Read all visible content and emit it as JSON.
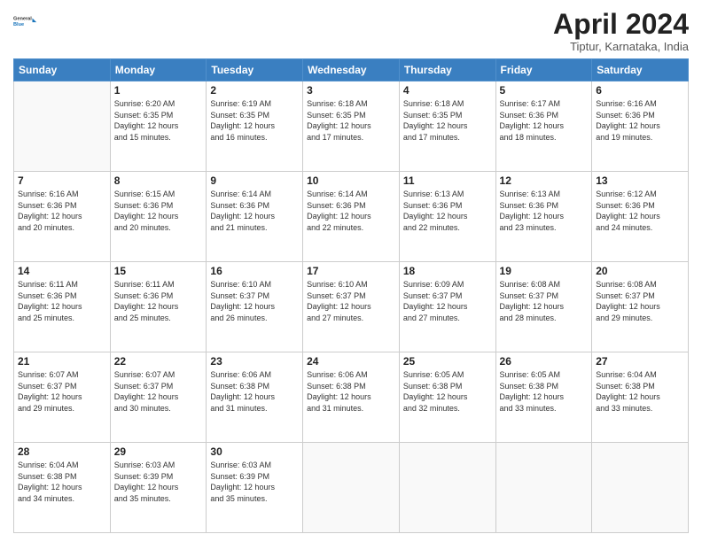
{
  "header": {
    "logo": {
      "line1": "General",
      "line2": "Blue"
    },
    "title": "April 2024",
    "subtitle": "Tiptur, Karnataka, India"
  },
  "calendar": {
    "days_of_week": [
      "Sunday",
      "Monday",
      "Tuesday",
      "Wednesday",
      "Thursday",
      "Friday",
      "Saturday"
    ],
    "weeks": [
      [
        {
          "day": "",
          "empty": true
        },
        {
          "day": "1",
          "sunrise": "6:20 AM",
          "sunset": "6:35 PM",
          "daylight": "12 hours and 15 minutes."
        },
        {
          "day": "2",
          "sunrise": "6:19 AM",
          "sunset": "6:35 PM",
          "daylight": "12 hours and 16 minutes."
        },
        {
          "day": "3",
          "sunrise": "6:18 AM",
          "sunset": "6:35 PM",
          "daylight": "12 hours and 17 minutes."
        },
        {
          "day": "4",
          "sunrise": "6:18 AM",
          "sunset": "6:35 PM",
          "daylight": "12 hours and 17 minutes."
        },
        {
          "day": "5",
          "sunrise": "6:17 AM",
          "sunset": "6:36 PM",
          "daylight": "12 hours and 18 minutes."
        },
        {
          "day": "6",
          "sunrise": "6:16 AM",
          "sunset": "6:36 PM",
          "daylight": "12 hours and 19 minutes."
        }
      ],
      [
        {
          "day": "7",
          "sunrise": "6:16 AM",
          "sunset": "6:36 PM",
          "daylight": "12 hours and 20 minutes."
        },
        {
          "day": "8",
          "sunrise": "6:15 AM",
          "sunset": "6:36 PM",
          "daylight": "12 hours and 20 minutes."
        },
        {
          "day": "9",
          "sunrise": "6:14 AM",
          "sunset": "6:36 PM",
          "daylight": "12 hours and 21 minutes."
        },
        {
          "day": "10",
          "sunrise": "6:14 AM",
          "sunset": "6:36 PM",
          "daylight": "12 hours and 22 minutes."
        },
        {
          "day": "11",
          "sunrise": "6:13 AM",
          "sunset": "6:36 PM",
          "daylight": "12 hours and 22 minutes."
        },
        {
          "day": "12",
          "sunrise": "6:13 AM",
          "sunset": "6:36 PM",
          "daylight": "12 hours and 23 minutes."
        },
        {
          "day": "13",
          "sunrise": "6:12 AM",
          "sunset": "6:36 PM",
          "daylight": "12 hours and 24 minutes."
        }
      ],
      [
        {
          "day": "14",
          "sunrise": "6:11 AM",
          "sunset": "6:36 PM",
          "daylight": "12 hours and 25 minutes."
        },
        {
          "day": "15",
          "sunrise": "6:11 AM",
          "sunset": "6:36 PM",
          "daylight": "12 hours and 25 minutes."
        },
        {
          "day": "16",
          "sunrise": "6:10 AM",
          "sunset": "6:37 PM",
          "daylight": "12 hours and 26 minutes."
        },
        {
          "day": "17",
          "sunrise": "6:10 AM",
          "sunset": "6:37 PM",
          "daylight": "12 hours and 27 minutes."
        },
        {
          "day": "18",
          "sunrise": "6:09 AM",
          "sunset": "6:37 PM",
          "daylight": "12 hours and 27 minutes."
        },
        {
          "day": "19",
          "sunrise": "6:08 AM",
          "sunset": "6:37 PM",
          "daylight": "12 hours and 28 minutes."
        },
        {
          "day": "20",
          "sunrise": "6:08 AM",
          "sunset": "6:37 PM",
          "daylight": "12 hours and 29 minutes."
        }
      ],
      [
        {
          "day": "21",
          "sunrise": "6:07 AM",
          "sunset": "6:37 PM",
          "daylight": "12 hours and 29 minutes."
        },
        {
          "day": "22",
          "sunrise": "6:07 AM",
          "sunset": "6:37 PM",
          "daylight": "12 hours and 30 minutes."
        },
        {
          "day": "23",
          "sunrise": "6:06 AM",
          "sunset": "6:38 PM",
          "daylight": "12 hours and 31 minutes."
        },
        {
          "day": "24",
          "sunrise": "6:06 AM",
          "sunset": "6:38 PM",
          "daylight": "12 hours and 31 minutes."
        },
        {
          "day": "25",
          "sunrise": "6:05 AM",
          "sunset": "6:38 PM",
          "daylight": "12 hours and 32 minutes."
        },
        {
          "day": "26",
          "sunrise": "6:05 AM",
          "sunset": "6:38 PM",
          "daylight": "12 hours and 33 minutes."
        },
        {
          "day": "27",
          "sunrise": "6:04 AM",
          "sunset": "6:38 PM",
          "daylight": "12 hours and 33 minutes."
        }
      ],
      [
        {
          "day": "28",
          "sunrise": "6:04 AM",
          "sunset": "6:38 PM",
          "daylight": "12 hours and 34 minutes."
        },
        {
          "day": "29",
          "sunrise": "6:03 AM",
          "sunset": "6:39 PM",
          "daylight": "12 hours and 35 minutes."
        },
        {
          "day": "30",
          "sunrise": "6:03 AM",
          "sunset": "6:39 PM",
          "daylight": "12 hours and 35 minutes."
        },
        {
          "day": "",
          "empty": true
        },
        {
          "day": "",
          "empty": true
        },
        {
          "day": "",
          "empty": true
        },
        {
          "day": "",
          "empty": true
        }
      ]
    ],
    "labels": {
      "sunrise": "Sunrise:",
      "sunset": "Sunset:",
      "daylight": "Daylight:"
    }
  }
}
